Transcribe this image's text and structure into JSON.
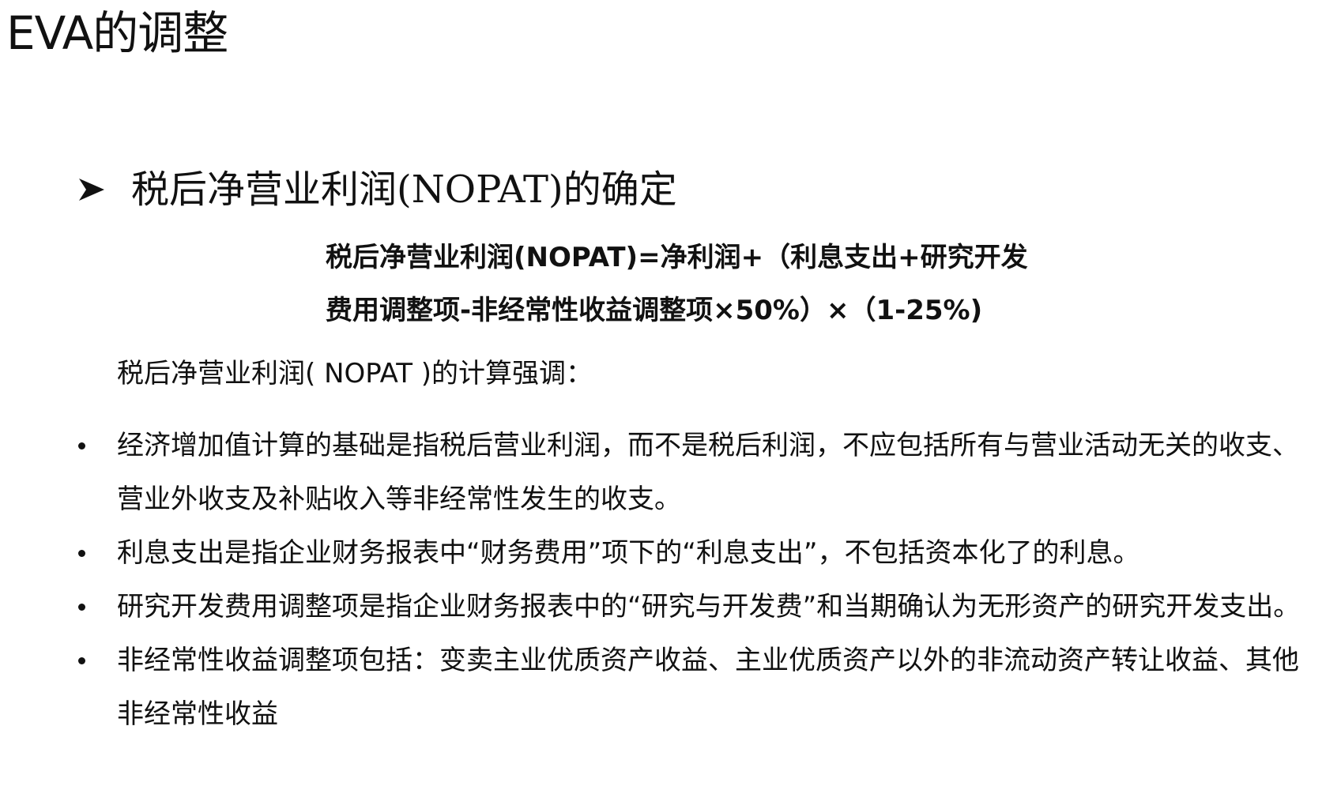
{
  "slide": {
    "title": "EVA的调整"
  },
  "section": {
    "icon": "arrow-bullet-icon",
    "heading": "税后净营业利润(NOPAT)的确定"
  },
  "formula": {
    "line1": "税后净营业利润(NOPAT)=净利润+（利息支出+研究开发",
    "line2": "费用调整项-非经常性收益调整项×50%）×（1-25%)"
  },
  "intro": "税后净营业利润( NOPAT )的计算强调：",
  "bullets": [
    "经济增加值计算的基础是指税后营业利润，而不是税后利润，不应包括所有与营业活动无关的收支、营业外收支及补贴收入等非经常性发生的收支。",
    "利息支出是指企业财务报表中“财务费用”项下的“利息支出”，不包括资本化了的利息。",
    "研究开发费用调整项是指企业财务报表中的“研究与开发费”和当期确认为无形资产的研究开发支出。",
    "非经常性收益调整项包括：变卖主业优质资产收益、主业优质资产以外的非流动资产转让收益、其他非经常性收益"
  ]
}
